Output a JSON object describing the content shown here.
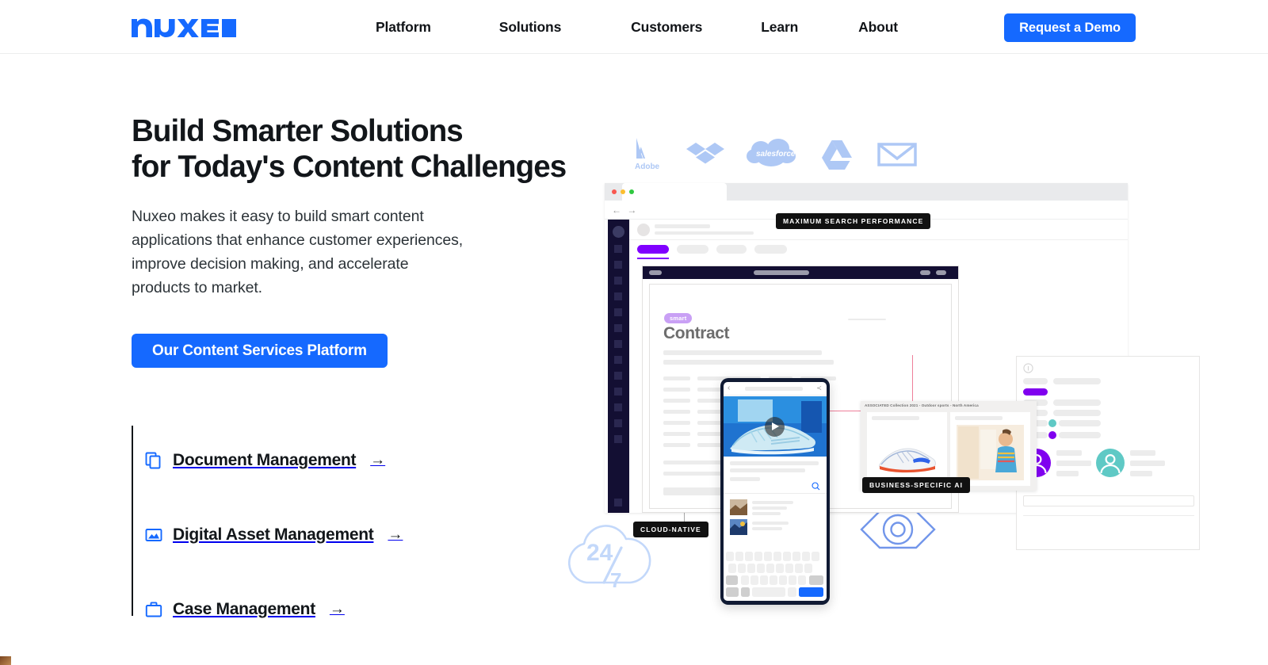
{
  "header": {
    "logo_text": "nuxeo",
    "logo_color": "#1569ff",
    "nav_items": [
      {
        "label": "Platform"
      },
      {
        "label": "Solutions"
      },
      {
        "label": "Customers"
      },
      {
        "label": "Learn"
      },
      {
        "label": "About"
      }
    ],
    "cta": {
      "label": "Request a Demo",
      "bg": "#1569ff",
      "text_color": "#ffffff"
    }
  },
  "hero": {
    "title": "Build Smarter Solutions\nfor Today's Content Challenges",
    "subtitle": "Nuxeo makes it easy to build smart content applications that enhance customer experiences, improve decision making, and accelerate products to market.",
    "cta": {
      "label": "Our Content Services Platform",
      "bg": "#1569ff",
      "text_color": "#ffffff"
    }
  },
  "features": [
    {
      "label": "Document Management",
      "icon": "documents-icon",
      "arrow": "→",
      "icon_color": "#1569ff"
    },
    {
      "label": "Digital Asset Management",
      "icon": "image-icon",
      "arrow": "→",
      "icon_color": "#1569ff"
    },
    {
      "label": "Case Management",
      "icon": "briefcase-icon",
      "arrow": "→",
      "icon_color": "#1569ff"
    }
  ],
  "illustration": {
    "partner_logos": [
      {
        "name": "adobe-logo",
        "label": "Adobe"
      },
      {
        "name": "dropbox-logo",
        "label": "Dropbox"
      },
      {
        "name": "salesforce-logo",
        "label": "salesforce"
      },
      {
        "name": "google-drive-logo",
        "label": "Google Drive"
      },
      {
        "name": "gmail-logo",
        "label": "Gmail"
      }
    ],
    "partner_logo_color": "#aec8f5",
    "badges": [
      {
        "name": "badge-maximum-search-performance",
        "label": "MAXIMUM SEARCH PERFORMANCE"
      },
      {
        "name": "badge-cloud-native",
        "label": "CLOUD-NATIVE"
      },
      {
        "name": "badge-business-specific-ai",
        "label": "BUSINESS-SPECIFIC AI"
      }
    ],
    "document": {
      "tag": "smart",
      "tag_bg": "#c9a0f5",
      "title": "Contract"
    },
    "product_panel": {
      "caption": "ASSOCIATED Collection 2021 - Outdoor sports - North America"
    },
    "cloud_graphic": {
      "number": "24",
      "divider": "/",
      "denominator": "7",
      "color": "#c3d8fa"
    },
    "eye_graphic": {
      "name": "eye-icon",
      "color": "#7296ea"
    },
    "accent_purple": "#8000ef",
    "accent_teal": "#5fc9c5",
    "sidebar_bg": "#130f33"
  }
}
